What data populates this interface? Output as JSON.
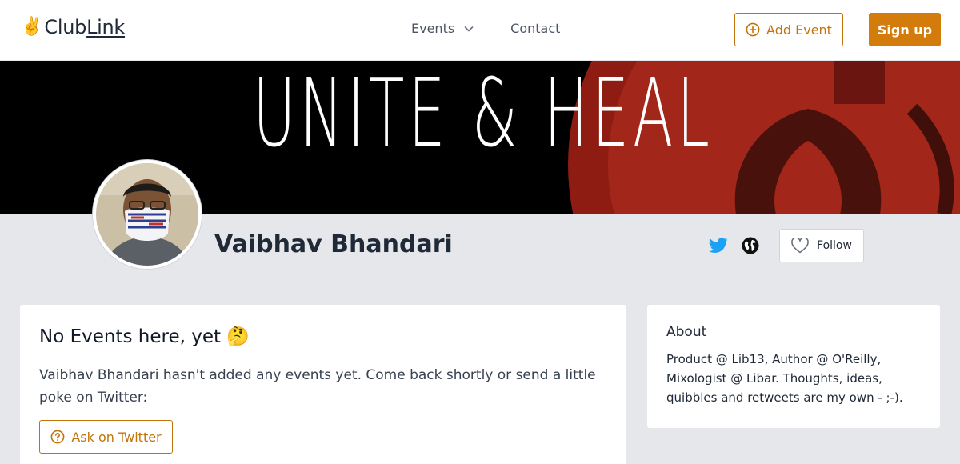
{
  "header": {
    "logo_emoji": "✌️",
    "brand_part1": "Club",
    "brand_part2": "Link",
    "nav": {
      "events_label": "Events",
      "contact_label": "Contact"
    },
    "add_event_label": "Add Event",
    "signup_label": "Sign up"
  },
  "banner": {
    "text": "UNITE & HEAL"
  },
  "profile": {
    "name": "Vaibhav Bhandari",
    "follow_label": "Follow",
    "social_icons": [
      "twitter-icon",
      "globe-icon"
    ]
  },
  "events_card": {
    "title": "No Events here, yet 🤔",
    "description": "Vaibhav Bhandari hasn't added any events yet. Come back shortly or send a little poke on Twitter:",
    "ask_label": "Ask on Twitter"
  },
  "about_card": {
    "title": "About",
    "text": "Product @ Lib13, Author @ O'Reilly, Mixologist @ Libar. Thoughts, ideas, quibbles and retweets are my own - ;-)."
  },
  "colors": {
    "accent": "#d47c0b",
    "twitter": "#1da1f2",
    "page_bg": "#e5e7eb"
  }
}
